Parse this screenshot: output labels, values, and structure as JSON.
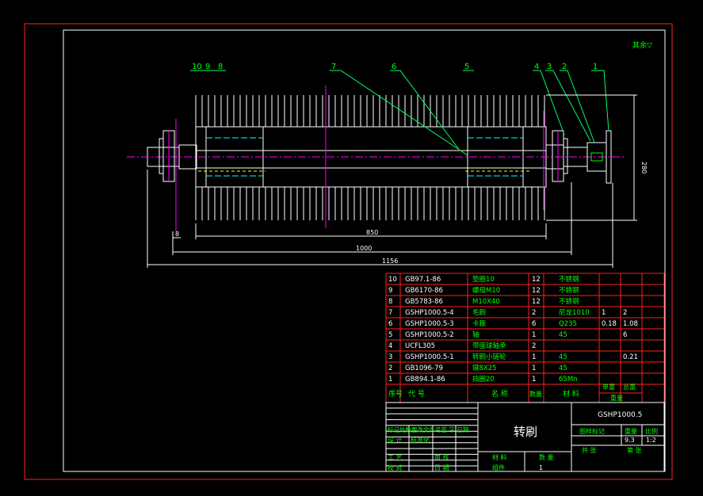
{
  "drawing": {
    "top_right_note": "其余▽",
    "dims": {
      "length_850": "850",
      "length_1000": "1000",
      "length_1156": "1156",
      "dim_8": "8",
      "dia_280": "280"
    },
    "balloons": [
      "10",
      "9",
      "8",
      "7",
      "6",
      "5",
      "4",
      "3",
      "2",
      "1"
    ]
  },
  "bom": {
    "rows": [
      {
        "no": "10",
        "code": "GB97.1-86",
        "name": "垫圈10",
        "qty": "12",
        "material": "不锈钢",
        "unit": "",
        "total": ""
      },
      {
        "no": "9",
        "code": "GB6170-86",
        "name": "螺母M10",
        "qty": "12",
        "material": "不锈钢",
        "unit": "",
        "total": ""
      },
      {
        "no": "8",
        "code": "GB5783-86",
        "name": "M10X40",
        "qty": "12",
        "material": "不锈钢",
        "unit": "",
        "total": ""
      },
      {
        "no": "7",
        "code": "GSHP1000.5-4",
        "name": "毛刷",
        "qty": "2",
        "material": "尼龙1010",
        "unit": "1",
        "total": "2"
      },
      {
        "no": "6",
        "code": "GSHP1000.5-3",
        "name": "卡箍",
        "qty": "6",
        "material": "Q235",
        "unit": "0.18",
        "total": "1.08"
      },
      {
        "no": "5",
        "code": "GSHP1000.5-2",
        "name": "轴",
        "qty": "1",
        "material": "45",
        "unit": "",
        "total": "6"
      },
      {
        "no": "4",
        "code": "UCFL305",
        "name": "带座球轴承",
        "qty": "2",
        "material": "",
        "unit": "",
        "total": ""
      },
      {
        "no": "3",
        "code": "GSHP1000.5-1",
        "name": "转刷小链轮",
        "qty": "1",
        "material": "45",
        "unit": "",
        "total": "0.21"
      },
      {
        "no": "2",
        "code": "GB1096-79",
        "name": "键8X25",
        "qty": "1",
        "material": "45",
        "unit": "",
        "total": ""
      },
      {
        "no": "1",
        "code": "GB894.1-86",
        "name": "挡圈20",
        "qty": "1",
        "material": "65Mn",
        "unit": "",
        "total": ""
      }
    ],
    "header": {
      "no": "序号",
      "code": "代 号",
      "name": "名 称",
      "qty": "数量",
      "material": "材 料",
      "unit_weight": "单重",
      "total_weight": "总重",
      "weight_group": "重量"
    }
  },
  "title_block": {
    "drawing_number": "GSHP1000.5",
    "title": "转刷",
    "stage_label": "图样标记",
    "weight_label": "重量",
    "scale_label": "比例",
    "weight_value": "9.3",
    "scale_value": "1:2",
    "sheet_label": "共 张",
    "sheet_label2": "第 张",
    "revision_row": "标记处数更改文件号签 字 日期",
    "design": "设 计",
    "standardize": "标准化",
    "process": "工 艺",
    "review": "审 核",
    "check": "校 对",
    "date": "日 期",
    "material_label": "材 料",
    "quantity_label": "数 量",
    "assembly_label": "组件",
    "assembly_qty": "1"
  },
  "colors": {
    "frame": "#ff2020",
    "line": "#ffffff",
    "dim": "#00ffff",
    "text": "#00ff00",
    "center": "#ff00ff",
    "leader": "#00ff66"
  }
}
